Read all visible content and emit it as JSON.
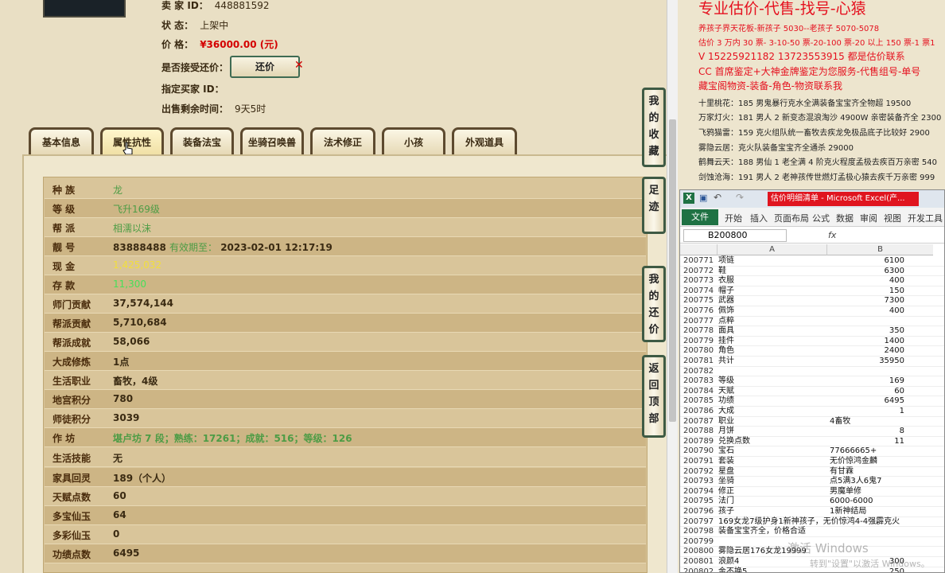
{
  "left": {
    "info": [
      {
        "label": "卖 家 ID：",
        "value": "448881592"
      },
      {
        "label": "状 态：",
        "value": "上架中"
      },
      {
        "label": "价 格：",
        "value": "¥36000.00 (元)"
      },
      {
        "label": "是否接受还价：",
        "value": ""
      },
      {
        "label": "指定买家 ID：",
        "value": ""
      },
      {
        "label": "出售剩余时间：",
        "value": "9天5时"
      }
    ],
    "counter_button": "还价",
    "tabs": [
      "基本信息",
      "属性抗性",
      "装备法宝",
      "坐骑召唤兽",
      "法术修正",
      "小孩",
      "外观道具"
    ],
    "side_buttons": [
      "我的收藏",
      "足迹",
      "我的还价",
      "返回顶部"
    ],
    "props": [
      {
        "label": "种 族",
        "value": "龙"
      },
      {
        "label": "等 级",
        "value": "飞升169级"
      },
      {
        "label": "帮 派",
        "value": "相濡以沫"
      },
      {
        "label": "靓 号",
        "value": "83888488",
        "extra": "有效期至：",
        "date": "2023-02-01 12:17:19"
      },
      {
        "label": "现 金",
        "value": "1,425,032"
      },
      {
        "label": "存 款",
        "value": "11,300"
      },
      {
        "label": "师门贡献",
        "value": "37,574,144"
      },
      {
        "label": "帮派贡献",
        "value": "5,710,684"
      },
      {
        "label": "帮派成就",
        "value": "58,066"
      },
      {
        "label": "大成修炼",
        "value": "1点"
      },
      {
        "label": "生活职业",
        "value": "畜牧，4级"
      },
      {
        "label": "地宫积分",
        "value": "780"
      },
      {
        "label": "师徒积分",
        "value": "3039"
      },
      {
        "label": "作 坊",
        "value": "堪卢坊 7 段；熟练：17261；成就：516；等级：126"
      },
      {
        "label": "生活技能",
        "value": "无"
      },
      {
        "label": "家具回灵",
        "value": "189（个人）"
      },
      {
        "label": "天赋点数",
        "value": "60"
      },
      {
        "label": "多宝仙玉",
        "value": "64"
      },
      {
        "label": "多彩仙玉",
        "value": "0"
      },
      {
        "label": "功绩点数",
        "value": "6495"
      }
    ]
  },
  "ad": {
    "title": "专业估价-代售-找号-心猿",
    "lines": [
      {
        "text": "养孩子界天花板-新孩子 5030--老孩子 5070-5078",
        "cls": "red"
      },
      {
        "text": "估价 3 万内 30 票- 3-10-50 票-20-100 票-20 以上 150 票-1 票1",
        "cls": "red"
      },
      {
        "text": "V 15225921182 13723553915 都是估价联系",
        "cls": "red"
      },
      {
        "text": "CC 首席鉴定+大神金牌鉴定为您服务-代售组号-单号",
        "cls": "red"
      },
      {
        "text": "藏宝阁物资-装备-角色-物资联系我",
        "cls": "red"
      },
      {
        "text": "十里桃花：185 男鬼暴行克水全满装备宝宝齐全物超 19500",
        "cls": "blk"
      },
      {
        "text": "万家灯火：181 男人 2 新变态混浪淘沙 4900W 亲密装备齐全 2300",
        "cls": "blk"
      },
      {
        "text": "飞鸦猫雷：159 克火组队统一畜牧去疾龙免极品底子比较好 2900",
        "cls": "blk"
      },
      {
        "text": "雾隐云居：克火队装备宝宝齐全通杀 29000",
        "cls": "blk"
      },
      {
        "text": "鹤舞云天：188 男仙 1 老全满 4 阶克火程度孟极去疾百万亲密 540",
        "cls": "blk"
      },
      {
        "text": "剑蚀沧海：191 男人 2 老神孩传世燃灯孟极心猿去疾千万亲密 999",
        "cls": "blk"
      }
    ]
  },
  "excel": {
    "title": "估价明细清单 - Microsoft Excel(产...",
    "file_tab": "文件",
    "menu": [
      "开始",
      "插入",
      "页面布局",
      "公式",
      "数据",
      "审阅",
      "视图",
      "开发工具"
    ],
    "name_box": "B200800",
    "fx": "fx",
    "col_a": "A",
    "col_b": "B",
    "rows": [
      {
        "n": "200771",
        "a": "项链",
        "b": "6100"
      },
      {
        "n": "200772",
        "a": "鞋",
        "b": "6300"
      },
      {
        "n": "200773",
        "a": "衣服",
        "b": "400"
      },
      {
        "n": "200774",
        "a": "帽子",
        "b": "150"
      },
      {
        "n": "200775",
        "a": "武器",
        "b": "7300"
      },
      {
        "n": "200776",
        "a": "佩饰",
        "b": "400"
      },
      {
        "n": "200777",
        "a": "点粹",
        "b": ""
      },
      {
        "n": "200778",
        "a": "面具",
        "b": "350"
      },
      {
        "n": "200779",
        "a": "挂件",
        "b": "1400"
      },
      {
        "n": "200780",
        "a": "角色",
        "b": "2400"
      },
      {
        "n": "200781",
        "a": "共计",
        "b": "35950"
      },
      {
        "n": "200782",
        "a": "",
        "b": ""
      },
      {
        "n": "200783",
        "a": "等级",
        "b": "169"
      },
      {
        "n": "200784",
        "a": "天赋",
        "b": "60"
      },
      {
        "n": "200785",
        "a": "功绩",
        "b": "6495"
      },
      {
        "n": "200786",
        "a": "大成",
        "b": "1"
      },
      {
        "n": "200787",
        "a": "职业",
        "c": "4畜牧"
      },
      {
        "n": "200788",
        "a": "月饼",
        "b": "8"
      },
      {
        "n": "200789",
        "a": "兑换点数",
        "b": "11"
      },
      {
        "n": "200790",
        "a": "宝石",
        "c": "77666665+"
      },
      {
        "n": "200791",
        "a": "套装",
        "c": "无价惊鸿金麟"
      },
      {
        "n": "200792",
        "a": "星盘",
        "c": "有甘霖"
      },
      {
        "n": "200793",
        "a": "坐骑",
        "c": "点5满3人6鬼7"
      },
      {
        "n": "200794",
        "a": "修正",
        "c": "男魔单修"
      },
      {
        "n": "200795",
        "a": "法门",
        "c": "6000-6000"
      },
      {
        "n": "200796",
        "a": "孩子",
        "c": "1新神结局"
      },
      {
        "n": "200797",
        "a": "169女龙7级护身1新神孩子，无价惊鸿4-4强霹克火",
        "b": ""
      },
      {
        "n": "200798",
        "a": "装备宝宝齐全，价格合适",
        "b": ""
      },
      {
        "n": "200799",
        "a": "",
        "b": ""
      },
      {
        "n": "200800",
        "a": "雾隐云居176女龙19999",
        "b": ""
      },
      {
        "n": "200801",
        "a": "浪颜4",
        "b": "300"
      },
      {
        "n": "200802",
        "a": "金不换5",
        "b": "250"
      }
    ]
  },
  "watermark": {
    "line1": "激活 Windows",
    "line2": "转到\"设置\"以激活 Windows。"
  },
  "colors": {
    "price": "#d40000",
    "ad_red": "#e5101e",
    "excel_green": "#1f7244",
    "tab_border": "#5d4a2f"
  }
}
